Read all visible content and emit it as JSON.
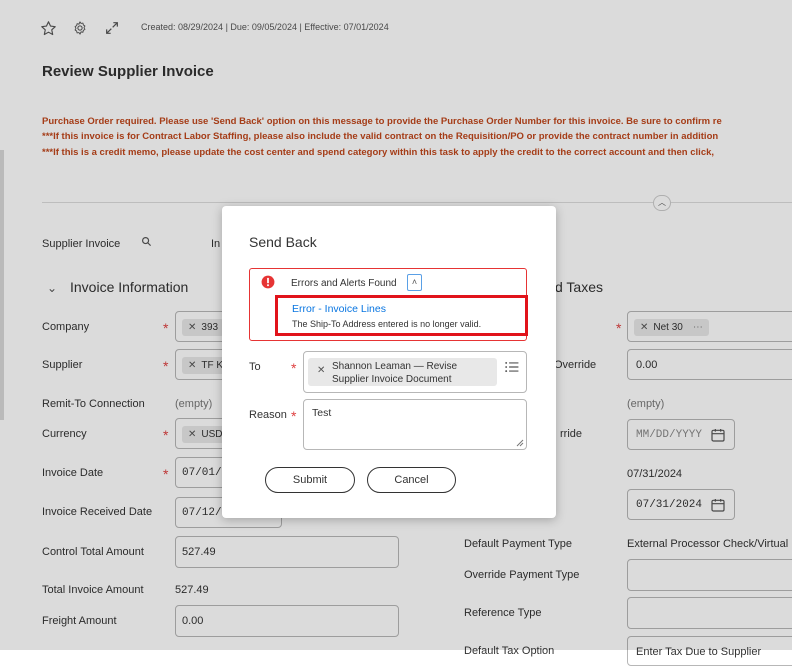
{
  "header": {
    "meta": "Created: 08/29/2024 | Due: 09/05/2024 | Effective: 07/01/2024",
    "title": "Review Supplier Invoice"
  },
  "alerts": {
    "line1": "Purchase Order required. Please use 'Send Back' option on this message to provide the Purchase Order Number for this invoice. Be sure to confirm re",
    "line2": "***If this invoice is for Contract Labor Staffing, please also include the valid contract on the Requisition/PO or provide the contract number in addition",
    "line3": "***If this is a credit memo, please update the cost center and spend category within this task to apply the credit to the correct account and then click,"
  },
  "tabs": {
    "supplier_invoice": "Supplier Invoice",
    "partial_second": "In"
  },
  "invoice_info": {
    "section_title": "Invoice Information",
    "company_label": "Company",
    "company_value": "393",
    "supplier_label": "Supplier",
    "supplier_value": "TF K",
    "remit_label": "Remit-To Connection",
    "remit_value": "(empty)",
    "currency_label": "Currency",
    "currency_value": "USD",
    "invoice_date_label": "Invoice Date",
    "invoice_date_value": "07/01/",
    "received_label": "Invoice Received Date",
    "received_value": "07/12/",
    "control_total_label": "Control Total Amount",
    "control_total_value": "527.49",
    "total_label": "Total Invoice Amount",
    "total_value": "527.49",
    "freight_label": "Freight Amount",
    "freight_value": "0.00"
  },
  "right_col": {
    "section_title_partial": "d Taxes",
    "terms_value": "Net 30",
    "override_label_partial": "Override",
    "override_value": "0.00",
    "empty_value": "(empty)",
    "override2_label_partial": "rride",
    "date_placeholder": "MM/DD/YYYY",
    "due_date_value": "07/31/2024",
    "date_input_value": "07/31/2024",
    "payment_type_label": "Default Payment Type",
    "payment_type_value": "External Processor Check/Virtual",
    "override_payment_label": "Override Payment Type",
    "reference_type_label": "Reference Type",
    "default_tax_label": "Default Tax Option",
    "default_tax_value": "Enter Tax Due to Supplier"
  },
  "modal": {
    "title": "Send Back",
    "errors_header": "Errors and Alerts Found",
    "error_link": "Error - Invoice Lines",
    "error_message": "The Ship-To Address entered is no longer valid.",
    "to_label": "To",
    "to_value_line1": "Shannon Leaman — Revise",
    "to_value_line2": "Supplier Invoice Document",
    "reason_label": "Reason",
    "reason_value": "Test",
    "submit_label": "Submit",
    "cancel_label": "Cancel"
  },
  "colors": {
    "alert_text": "#c0471c",
    "error_red": "#e63434",
    "link_blue": "#0875e1",
    "highlight_red": "#e1131b"
  }
}
